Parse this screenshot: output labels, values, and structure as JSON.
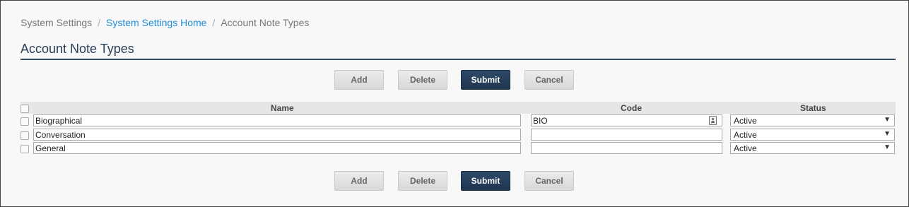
{
  "breadcrumb": {
    "items": [
      "System Settings",
      "System Settings Home",
      "Account Note Types"
    ],
    "separator": "/"
  },
  "page": {
    "title": "Account Note Types"
  },
  "toolbar": {
    "add_label": "Add",
    "delete_label": "Delete",
    "submit_label": "Submit",
    "cancel_label": "Cancel"
  },
  "table": {
    "headers": {
      "name": "Name",
      "code": "Code",
      "status": "Status"
    },
    "rows": [
      {
        "name": "Biographical",
        "code": "BIO",
        "status": "Active"
      },
      {
        "name": "Conversation",
        "code": "",
        "status": "Active"
      },
      {
        "name": "General",
        "code": "",
        "status": "Active"
      }
    ]
  },
  "colors": {
    "link": "#1f8dd6",
    "primary_button": "#24405d",
    "title_rule": "#2f4a63"
  },
  "icons": {
    "code_field_icon": "contact-card-icon",
    "select_arrow": "chevron-down-icon"
  }
}
